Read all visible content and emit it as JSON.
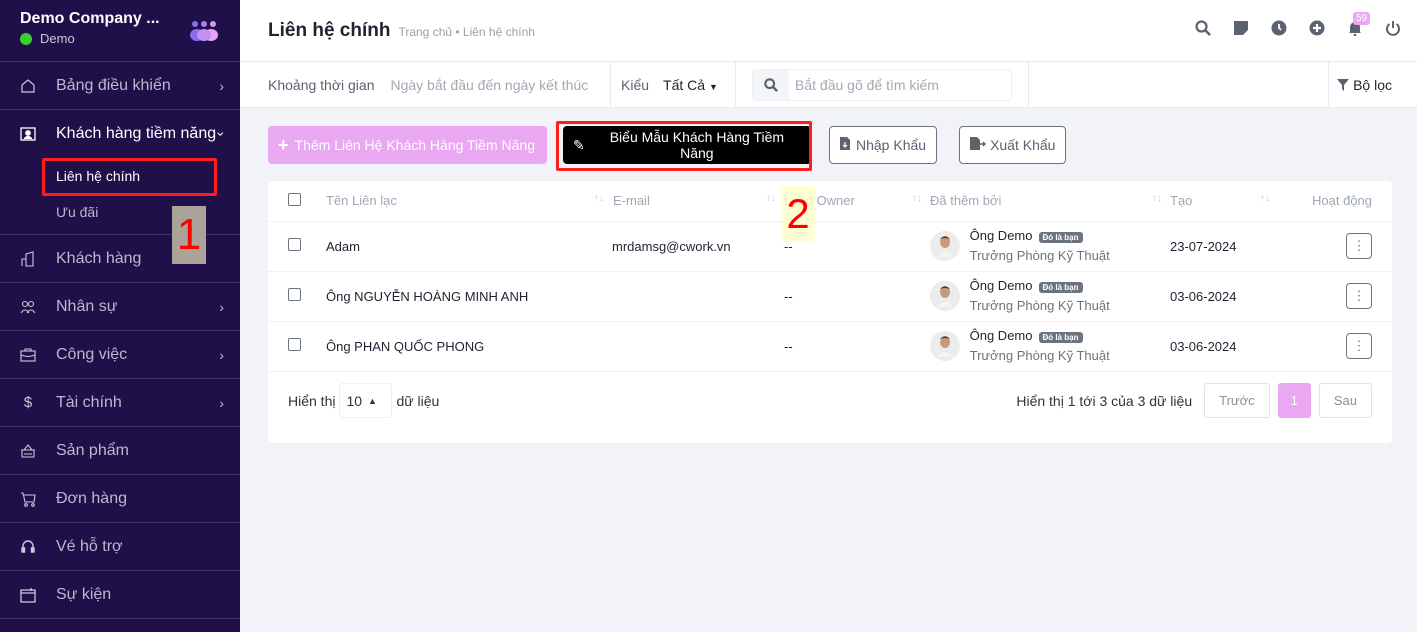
{
  "sidebar": {
    "company": "Demo Company ...",
    "workspace": "Demo",
    "items": [
      {
        "label": "Bảng điều khiển",
        "icon": "home-icon",
        "chevron": true
      },
      {
        "label": "Khách hàng tiềm năng",
        "icon": "contact-card-icon",
        "expanded": true,
        "children": [
          {
            "label": "Liên hệ chính",
            "active": true
          },
          {
            "label": "Ưu đãi"
          }
        ]
      },
      {
        "label": "Khách hàng",
        "icon": "building-icon"
      },
      {
        "label": "Nhân sự",
        "icon": "users-icon",
        "chevron": true
      },
      {
        "label": "Công việc",
        "icon": "briefcase-icon",
        "chevron": true
      },
      {
        "label": "Tài chính",
        "icon": "dollar-icon",
        "chevron": true
      },
      {
        "label": "Sản phẩm",
        "icon": "basket-icon"
      },
      {
        "label": "Đơn hàng",
        "icon": "cart-icon"
      },
      {
        "label": "Vé hỗ trợ",
        "icon": "headset-icon"
      },
      {
        "label": "Sự kiện",
        "icon": "calendar-icon"
      }
    ]
  },
  "annotations": {
    "mark1": "1",
    "mark2": "2"
  },
  "header": {
    "title": "Liên hệ chính",
    "breadcrumb": "Trang chủ • Liên hệ chính",
    "notification_count": "59"
  },
  "filters": {
    "date_label": "Khoảng thời gian",
    "date_placeholder": "Ngày bắt đầu đến ngày kết thúc",
    "type_label": "Kiểu",
    "type_value": "Tất Cả",
    "search_placeholder": "Bắt đầu gõ để tìm kiếm",
    "filter_label": "Bộ lọc"
  },
  "actions": {
    "add": "Thêm Liên Hệ Khách Hàng Tiềm Năng",
    "form": "Biểu Mẫu Khách Hàng Tiềm Năng",
    "import": "Nhập Khẩu",
    "export": "Xuất Khẩu"
  },
  "table": {
    "columns": [
      "Tên Liên lạc",
      "E-mail",
      "Lead Owner",
      "Đã thêm bởi",
      "Tạo",
      "Hoạt động"
    ],
    "rows": [
      {
        "name": "Adam",
        "email": "mrdamsg@cwork.vn",
        "owner": "--",
        "added_by": "Ông Demo",
        "tag": "Đó là bạn",
        "role": "Trưởng Phòng Kỹ Thuật",
        "created": "23-07-2024"
      },
      {
        "name": "Ông NGUYỄN HOÀNG MINH ANH",
        "email": "",
        "owner": "--",
        "added_by": "Ông Demo",
        "tag": "Đó là bạn",
        "role": "Trưởng Phòng Kỹ Thuật",
        "created": "03-06-2024"
      },
      {
        "name": "Ông PHAN QUỐC PHONG",
        "email": "",
        "owner": "--",
        "added_by": "Ông Demo",
        "tag": "Đó là bạn",
        "role": "Trưởng Phòng Kỹ Thuật",
        "created": "03-06-2024"
      }
    ]
  },
  "footer": {
    "show_label": "Hiển thị",
    "page_size": "10",
    "records_label": "dữ liệu",
    "summary": "Hiển thị 1 tới 3 của 3 dữ liệu",
    "prev": "Trước",
    "current_page": "1",
    "next": "Sau"
  }
}
